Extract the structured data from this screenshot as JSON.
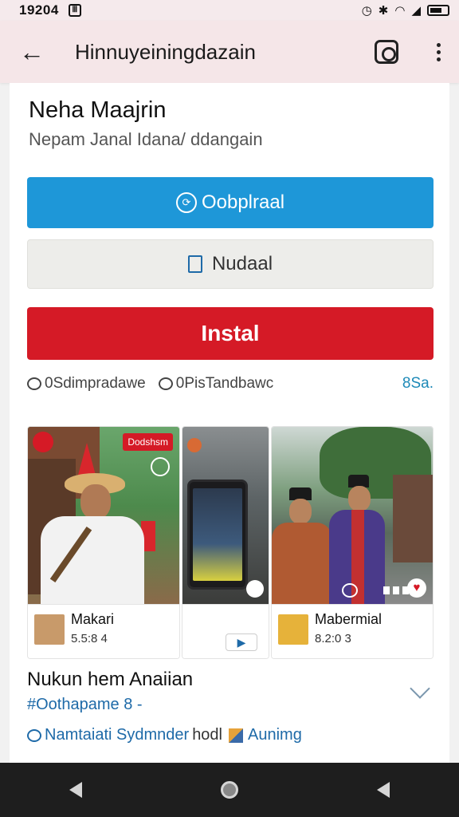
{
  "status_bar": {
    "time": "19204",
    "notification_glyph": "Ⅲ",
    "icons": [
      "alarm-icon",
      "bluetooth-icon",
      "wifi-icon",
      "signal-icon",
      "battery-icon"
    ]
  },
  "app_bar": {
    "title": "Hinnuyeiningdazain",
    "actions": [
      "back-icon",
      "instagram-icon",
      "more-icon"
    ]
  },
  "profile": {
    "name": "Neha Maajrin",
    "subtitle": "Nepam Janal Idana/ ddangain"
  },
  "buttons": {
    "primary_label": "Oobplraal",
    "secondary_label": "Nudaal",
    "install_label": "Instal"
  },
  "stats": {
    "left_label": "0Sdimpradawe",
    "middle_label": "0PisTandbawc",
    "right_label": "8Sa."
  },
  "gallery": {
    "items": [
      {
        "badge": "Dodshsm",
        "title": "Makari",
        "meta": "5.5:8 4"
      },
      {
        "title": "",
        "meta": ""
      },
      {
        "title": "Mabermial",
        "meta": "8.2:0 3"
      }
    ]
  },
  "section": {
    "title": "Nukun hem Anaiian",
    "tag": "#Oothapame 8 -",
    "link_icon_label": "Namtaiati Sydmnder",
    "link_plain": "hodl",
    "link_end": "Aunimg"
  },
  "colors": {
    "primary": "#1e97d8",
    "install": "#d51a26",
    "link": "#1e6aa8"
  }
}
